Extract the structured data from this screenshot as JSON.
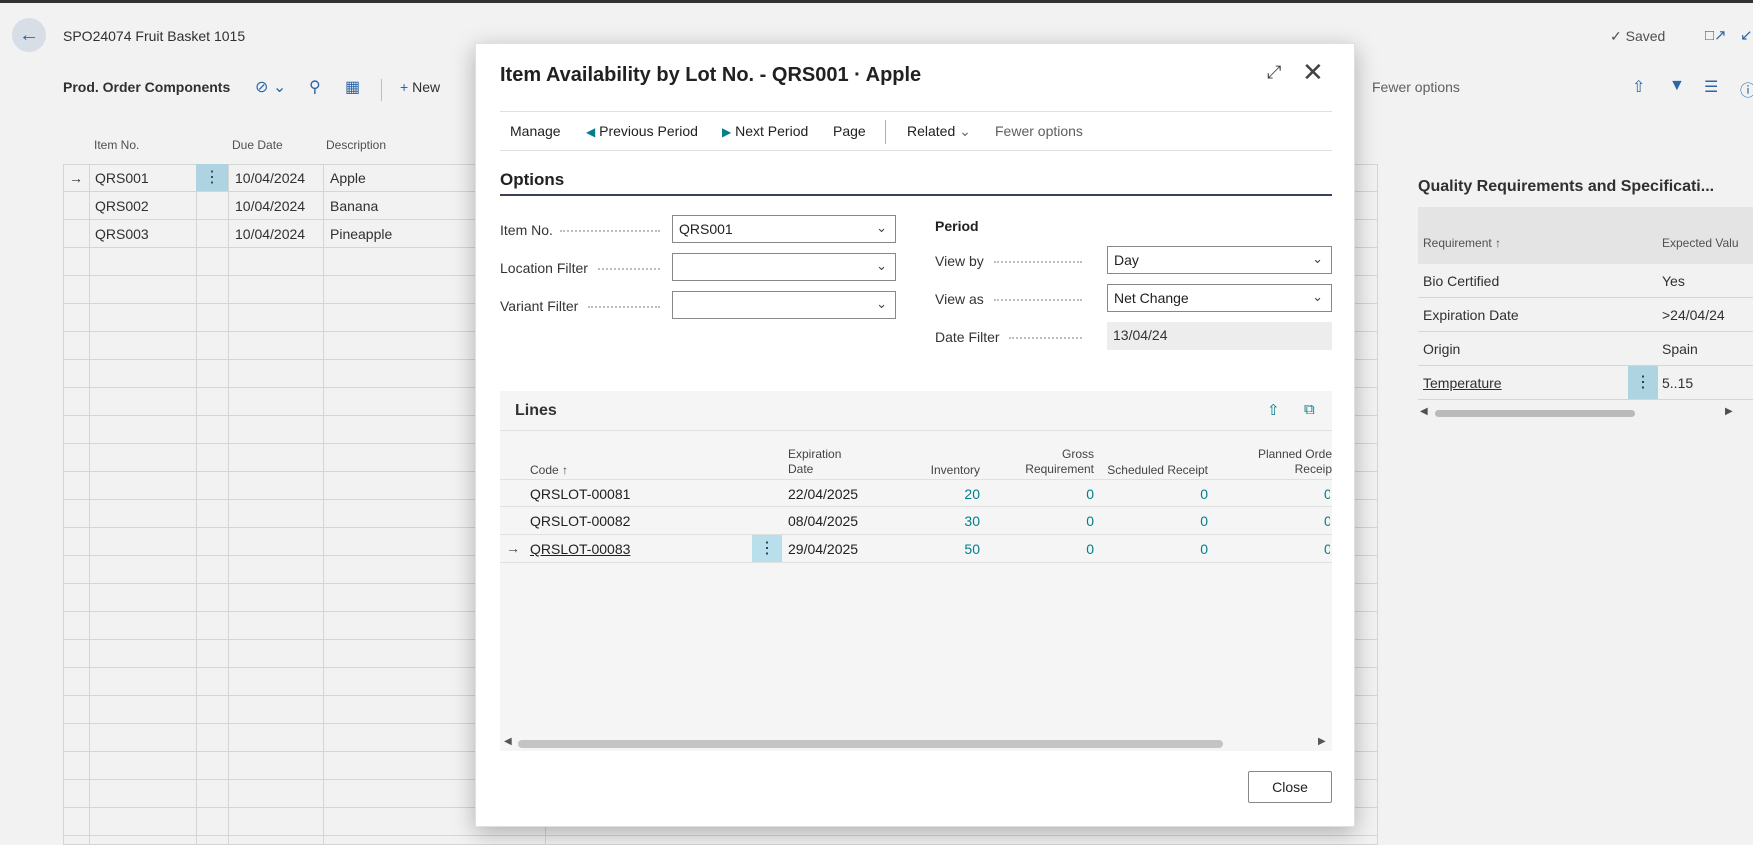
{
  "background": {
    "doc_title": "SPO24074 Fruit Basket 1015",
    "saved_label": "Saved",
    "actions": {
      "section_title": "Prod. Order Components",
      "new_label": "New",
      "fewer_options": "Fewer options"
    },
    "grid": {
      "columns": [
        "Item No.",
        "Due Date",
        "Description"
      ],
      "rows": [
        {
          "item_no": "QRS001",
          "due_date": "10/04/2024",
          "description": "Apple"
        },
        {
          "item_no": "QRS002",
          "due_date": "10/04/2024",
          "description": "Banana"
        },
        {
          "item_no": "QRS003",
          "due_date": "10/04/2024",
          "description": "Pineapple"
        }
      ]
    },
    "factbox": {
      "title": "Quality Requirements and Specificati...",
      "columns": [
        "Requirement",
        "Expected Valu"
      ],
      "rows": [
        {
          "requirement": "Bio Certified",
          "expected": "Yes"
        },
        {
          "requirement": "Expiration Date",
          "expected": ">24/04/24"
        },
        {
          "requirement": "Origin",
          "expected": "Spain"
        },
        {
          "requirement": "Temperature",
          "expected": "5..15"
        }
      ]
    }
  },
  "dialog": {
    "title": "Item Availability by Lot No. - QRS001 · Apple",
    "menu": {
      "manage": "Manage",
      "previous_period": "Previous Period",
      "next_period": "Next Period",
      "page": "Page",
      "related": "Related",
      "fewer_options": "Fewer options"
    },
    "options": {
      "title": "Options",
      "item_no": {
        "label": "Item No.",
        "value": "QRS001"
      },
      "location_filter": {
        "label": "Location Filter",
        "value": ""
      },
      "variant_filter": {
        "label": "Variant Filter",
        "value": ""
      },
      "period_title": "Period",
      "view_by": {
        "label": "View by",
        "value": "Day"
      },
      "view_as": {
        "label": "View as",
        "value": "Net Change"
      },
      "date_filter": {
        "label": "Date Filter",
        "value": "13/04/24"
      }
    },
    "lines": {
      "title": "Lines",
      "columns": {
        "code": "Code",
        "expiration_1": "Expiration",
        "expiration_2": "Date",
        "inventory": "Inventory",
        "gross_1": "Gross",
        "gross_2": "Requirement",
        "scheduled": "Scheduled Receipt",
        "planned_1": "Planned Orde",
        "planned_2": "Receip"
      },
      "rows": [
        {
          "code": "QRSLOT-00081",
          "expiration": "22/04/2025",
          "inventory": "20",
          "gross": "0",
          "scheduled": "0",
          "planned": "0"
        },
        {
          "code": "QRSLOT-00082",
          "expiration": "08/04/2025",
          "inventory": "30",
          "gross": "0",
          "scheduled": "0",
          "planned": "0"
        },
        {
          "code": "QRSLOT-00083",
          "expiration": "29/04/2025",
          "inventory": "50",
          "gross": "0",
          "scheduled": "0",
          "planned": "0"
        }
      ]
    },
    "close_label": "Close"
  }
}
